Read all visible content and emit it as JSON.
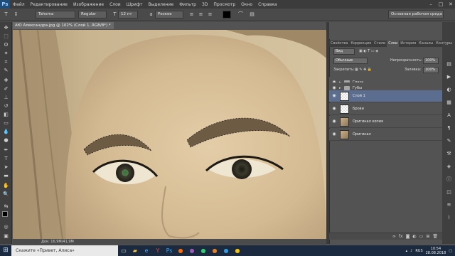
{
  "app": {
    "logo": "Ps"
  },
  "menu": [
    "Файл",
    "Редактирование",
    "Изображение",
    "Слои",
    "Шрифт",
    "Выделение",
    "Фильтр",
    "3D",
    "Просмотр",
    "Окно",
    "Справка"
  ],
  "options": {
    "font_family": "Tahoma",
    "font_style": "Regular",
    "font_size": "12 пт",
    "antialias": "Резкое",
    "workspace": "Основная рабочая среда"
  },
  "document": {
    "tab_title": "АЮ Александра.jpg @ 102% (Слой 1, RGB/8*) *",
    "status": "Док: 16,9М/41,9М"
  },
  "panel": {
    "tabs": [
      "Свойства",
      "Коррекция",
      "Стили",
      "Слои",
      "История",
      "Каналы",
      "Контуры"
    ],
    "active_tab": "Слои",
    "kind_filter": "Вид",
    "blend_mode": "Обычные",
    "opacity_label": "Непрозрачность:",
    "opacity_value": "100%",
    "lock_label": "Закрепить:",
    "fill_label": "Заливка:",
    "fill_value": "100%",
    "layers": [
      {
        "name": "Глаза",
        "type": "folder",
        "selected": false
      },
      {
        "name": "Губы",
        "type": "folder",
        "selected": false
      },
      {
        "name": "Слой 1",
        "type": "layer",
        "selected": true
      },
      {
        "name": "Брови",
        "type": "layer",
        "selected": false
      },
      {
        "name": "Оригинал копия",
        "type": "photo",
        "selected": false
      },
      {
        "name": "Оригинал",
        "type": "photo",
        "selected": false
      }
    ]
  },
  "taskbar": {
    "search_placeholder": "Скажите «Привет, Алиса»",
    "language": "RUS",
    "time": "10:54",
    "date": "28.08.2018"
  },
  "colors": {
    "selected_layer": "#5b6e8f",
    "panel_bg": "#535353",
    "toolbar_bg": "#3f3f3f",
    "taskbar_bg": "#1b2a3e"
  },
  "icons": [
    "ps-logo",
    "minimize-icon",
    "maximize-icon",
    "close-icon",
    "move-tool-icon",
    "marquee-tool-icon",
    "lasso-tool-icon",
    "magic-wand-icon",
    "crop-icon",
    "eyedropper-icon",
    "brush-icon",
    "stamp-icon",
    "eraser-icon",
    "gradient-icon",
    "dodge-icon",
    "pen-icon",
    "type-icon",
    "path-select-icon",
    "shape-icon",
    "hand-icon",
    "zoom-icon",
    "eye-icon",
    "folder-icon",
    "windows-start-icon"
  ]
}
